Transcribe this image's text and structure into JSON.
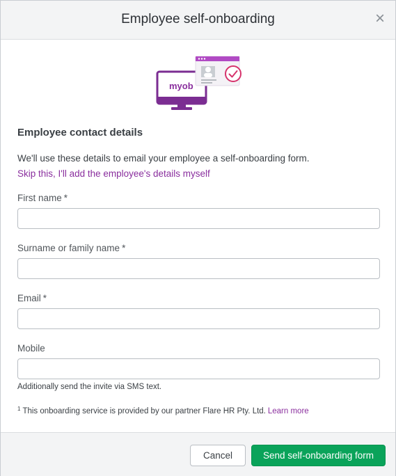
{
  "dialog": {
    "title": "Employee self-onboarding",
    "close_icon": "close-icon"
  },
  "illustration": {
    "logo_text": "myob",
    "icon": "computer-with-profile-card-icon"
  },
  "section": {
    "heading": "Employee contact details",
    "intro": "We'll use these details to email your employee a self-onboarding form.",
    "skip_link": "Skip this, I'll add the employee's details myself"
  },
  "fields": {
    "first_name": {
      "label": "First name",
      "required_mark": "*",
      "value": ""
    },
    "surname": {
      "label": "Surname or family name",
      "required_mark": "*",
      "value": ""
    },
    "email": {
      "label": "Email",
      "required_mark": "*",
      "value": ""
    },
    "mobile": {
      "label": "Mobile",
      "value": "",
      "helper": "Additionally send the invite via SMS text."
    }
  },
  "footnote": {
    "marker": "1",
    "text": "This onboarding service is provided by our partner Flare HR Pty. Ltd.",
    "link": "Learn more"
  },
  "footer": {
    "cancel_label": "Cancel",
    "submit_label": "Send self-onboarding form"
  },
  "colors": {
    "accent_purple": "#8a2f9e",
    "primary_green": "#0aa35a",
    "header_bg": "#f3f4f5"
  }
}
